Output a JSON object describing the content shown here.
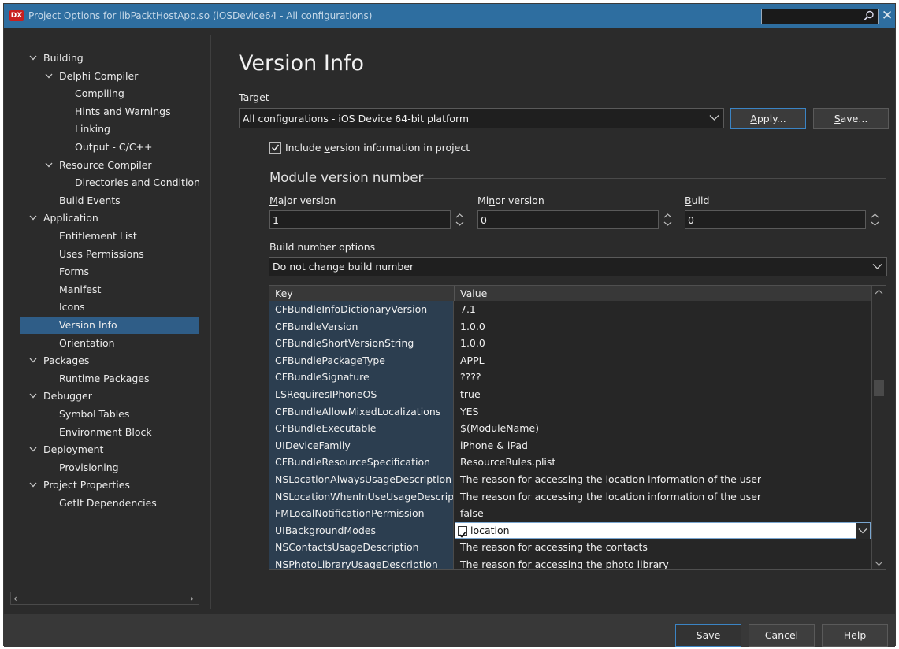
{
  "window": {
    "app_icon": "DX",
    "title": "Project Options for libPacktHostApp.so  (iOSDevice64 - All configurations)",
    "search_value": "",
    "search_icon": "search-icon",
    "close_icon": "close-icon"
  },
  "sidebar": {
    "items": [
      {
        "label": "Building",
        "expandable": true
      },
      {
        "label": "Delphi Compiler",
        "expandable": true
      },
      {
        "label": "Compiling"
      },
      {
        "label": "Hints and Warnings"
      },
      {
        "label": "Linking"
      },
      {
        "label": "Output - C/C++"
      },
      {
        "label": "Resource Compiler",
        "expandable": true
      },
      {
        "label": "Directories and Conditiona"
      },
      {
        "label": "Build Events"
      },
      {
        "label": "Application",
        "expandable": true
      },
      {
        "label": "Entitlement List"
      },
      {
        "label": "Uses Permissions"
      },
      {
        "label": "Forms"
      },
      {
        "label": "Manifest"
      },
      {
        "label": "Icons"
      },
      {
        "label": "Version Info",
        "selected": true
      },
      {
        "label": "Orientation"
      },
      {
        "label": "Packages",
        "expandable": true
      },
      {
        "label": "Runtime Packages"
      },
      {
        "label": "Debugger",
        "expandable": true
      },
      {
        "label": "Symbol Tables"
      },
      {
        "label": "Environment Block"
      },
      {
        "label": "Deployment",
        "expandable": true
      },
      {
        "label": "Provisioning"
      },
      {
        "label": "Project Properties",
        "expandable": true
      },
      {
        "label": "GetIt Dependencies"
      }
    ]
  },
  "main": {
    "title": "Version Info",
    "target_label_prefix": "T",
    "target_label_rest": "arget",
    "target_value": "All configurations - iOS Device 64-bit platform",
    "apply_prefix": "A",
    "apply_rest": "pply...",
    "save_prefix": "S",
    "save_rest": "ave...",
    "include_pre": "Include ",
    "include_u": "v",
    "include_post": "ersion information in project",
    "include_checked": true,
    "module_section": "Module version number",
    "major_prefix": "M",
    "major_rest": "ajor version",
    "major_value": "1",
    "minor_pre": "Mi",
    "minor_u": "n",
    "minor_post": "or version",
    "minor_value": "0",
    "build_prefix": "B",
    "build_rest": "uild",
    "build_value": "0",
    "build_options_label": "Build number options",
    "build_options_value": "Do not change build number"
  },
  "grid": {
    "headers": [
      "Key",
      "Value"
    ],
    "rows": [
      {
        "key": "CFBundleInfoDictionaryVersion",
        "value": "7.1"
      },
      {
        "key": "CFBundleVersion",
        "value": "1.0.0"
      },
      {
        "key": "CFBundleShortVersionString",
        "value": "1.0.0"
      },
      {
        "key": "CFBundlePackageType",
        "value": "APPL"
      },
      {
        "key": "CFBundleSignature",
        "value": "????"
      },
      {
        "key": "LSRequiresIPhoneOS",
        "value": "true"
      },
      {
        "key": "CFBundleAllowMixedLocalizations",
        "value": "YES"
      },
      {
        "key": "CFBundleExecutable",
        "value": "$(ModuleName)"
      },
      {
        "key": "UIDeviceFamily",
        "value": "iPhone & iPad"
      },
      {
        "key": "CFBundleResourceSpecification",
        "value": "ResourceRules.plist"
      },
      {
        "key": "NSLocationAlwaysUsageDescription",
        "value": "The reason for accessing the location information of the user"
      },
      {
        "key": "NSLocationWhenInUseUsageDescription",
        "value": "The reason for accessing the location information of the user"
      },
      {
        "key": "FMLocalNotificationPermission",
        "value": "false"
      },
      {
        "key": "UIBackgroundModes",
        "value": "location",
        "editing": true
      },
      {
        "key": "NSContactsUsageDescription",
        "value": "The reason for accessing the contacts"
      },
      {
        "key": "NSPhotoLibraryUsageDescription",
        "value": "The reason for accessing the photo library"
      }
    ]
  },
  "footer": {
    "save": "Save",
    "cancel": "Cancel",
    "help": "Help"
  },
  "colors": {
    "titlebar": "#2e6ea0",
    "selection": "#2f5d87",
    "accent_border": "#3b84c4",
    "background": "#2b2b2b"
  }
}
